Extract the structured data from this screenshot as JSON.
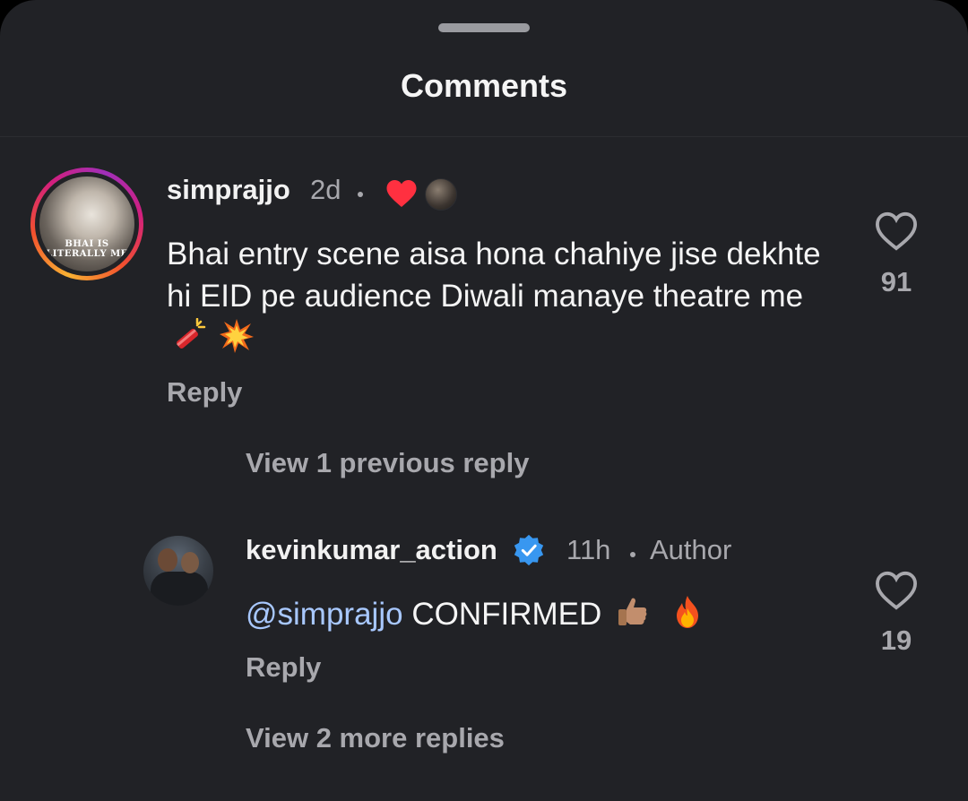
{
  "sheet": {
    "title": "Comments"
  },
  "comment1": {
    "username": "simprajjo",
    "time": "2d",
    "avatar_caption_line1": "BHAI IS",
    "avatar_caption_line2": "LITERALLY ME",
    "text": "Bhai entry scene aisa hona chahiye jise dekhte hi EID pe audience Diwali manaye theatre me",
    "emojis": [
      "firecracker-icon",
      "explosion-icon"
    ],
    "reply_label": "Reply",
    "like_count": "91",
    "liked_by_author_icon": "heart-icon",
    "view_previous": "View 1 previous reply"
  },
  "reply1": {
    "username": "kevinkumar_action",
    "time": "11h",
    "author_badge": "Author",
    "mention": "@simprajjo",
    "text": "CONFIRMED",
    "emojis": [
      "thumbs-up-icon",
      "fire-icon"
    ],
    "reply_label": "Reply",
    "like_count": "19",
    "view_more": "View 2 more replies"
  },
  "colors": {
    "background": "#212226",
    "text_primary": "#f5f5f5",
    "text_secondary": "#a8a8ad",
    "mention": "#a8c8ff",
    "verified": "#3897f0",
    "liked_heart": "#ff3040"
  }
}
